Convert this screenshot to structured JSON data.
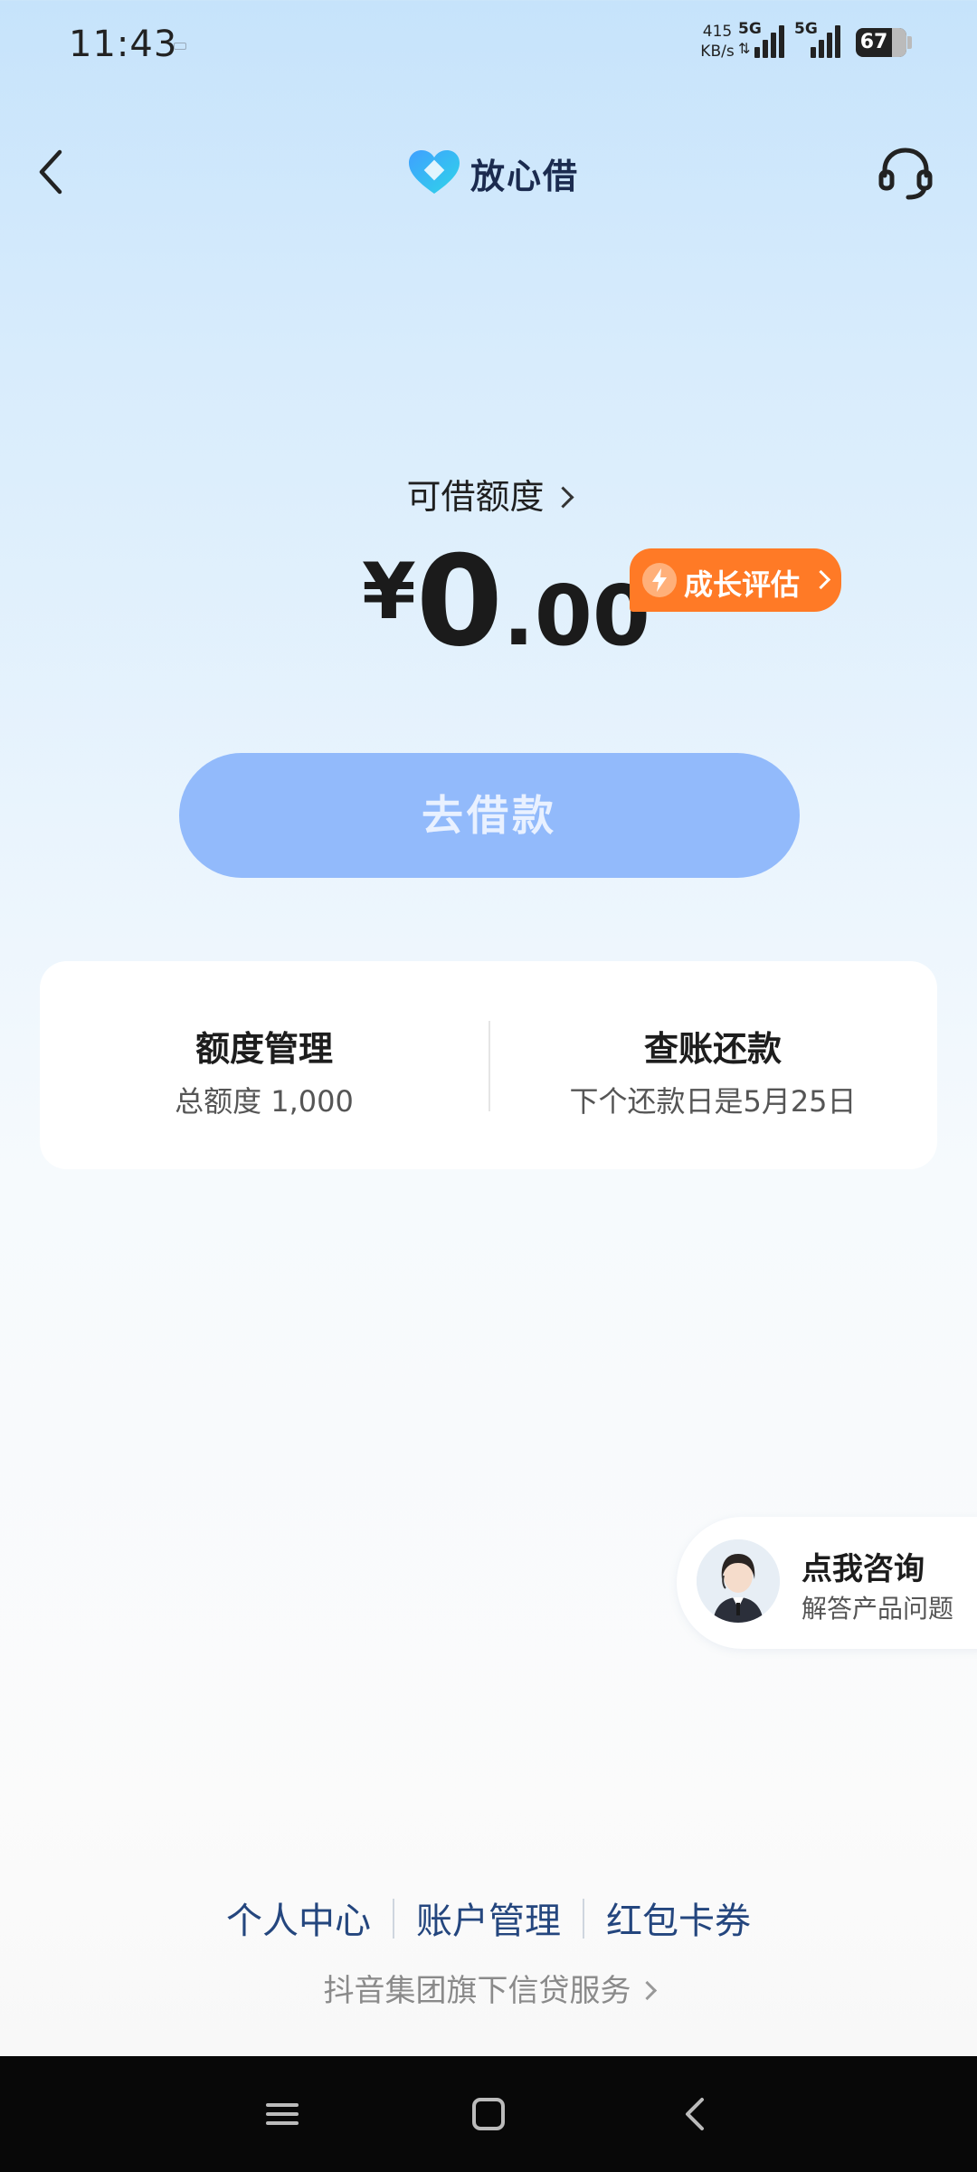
{
  "status_bar": {
    "time": "11:43",
    "net_speed_value": "415",
    "net_speed_unit": "KB/s",
    "signal1_label": "5G",
    "signal2_label": "5G",
    "battery_level": "67"
  },
  "header": {
    "back_icon": "chevron-left-icon",
    "brand_name": "放心借",
    "support_icon": "headset-icon"
  },
  "main": {
    "limit_label": "可借额度",
    "amount_currency": "¥",
    "amount_integer": "0",
    "amount_decimal": ".00",
    "growth_button_label": "成长评估",
    "borrow_button_label": "去借款"
  },
  "card": {
    "left": {
      "title": "额度管理",
      "subtitle": "总额度 1,000"
    },
    "right": {
      "title": "查账还款",
      "subtitle": "下个还款日是5月25日"
    }
  },
  "consult": {
    "title": "点我咨询",
    "subtitle": "解答产品问题"
  },
  "footer": {
    "links": [
      "个人中心",
      "账户管理",
      "红包卡券"
    ],
    "note": "抖音集团旗下信贷服务"
  },
  "system_nav": {
    "icons": [
      "menu-icon",
      "home-icon",
      "back-icon"
    ]
  },
  "colors": {
    "accent_orange": "#ff7a26",
    "borrow_button": "#92bafb",
    "link_blue": "#24467e"
  }
}
